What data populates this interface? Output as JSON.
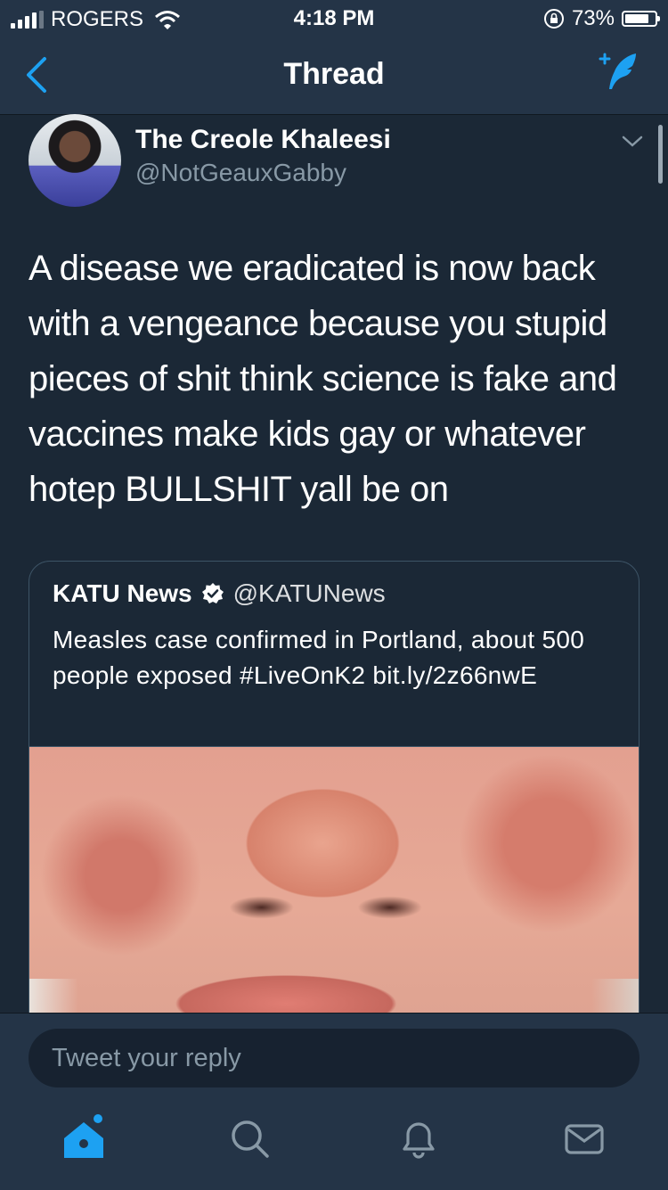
{
  "status_bar": {
    "carrier": "ROGERS",
    "time": "4:18 PM",
    "battery": "73%",
    "battery_level": 0.73,
    "icons": [
      "signal-icon",
      "wifi-icon",
      "rotation-lock-icon",
      "battery-icon"
    ]
  },
  "nav": {
    "title": "Thread",
    "back_icon": "chevron-left-icon",
    "compose_icon": "compose-tweet-icon"
  },
  "tweet": {
    "author_name": "The Creole Khaleesi",
    "author_handle": "@NotGeauxGabby",
    "text": "A disease we eradicated is now back with a vengeance because you stupid pieces of shit think science is fake and vaccines make kids gay or whatever hotep BULLSHIT yall be on"
  },
  "quoted_tweet": {
    "author_name": "KATU News",
    "author_handle": "@KATUNews",
    "verified": true,
    "text": "Measles case confirmed in Portland, about 500 people exposed #LiveOnK2 bit.ly/2z66nwE"
  },
  "reply": {
    "placeholder": "Tweet your reply"
  },
  "tabbar": {
    "items": [
      "home-icon",
      "search-icon",
      "notifications-icon",
      "messages-icon"
    ],
    "active": "home-icon"
  },
  "colors": {
    "background": "#1b2836",
    "bar": "#243447",
    "accent": "#1da1f2",
    "muted": "#8899a6"
  }
}
